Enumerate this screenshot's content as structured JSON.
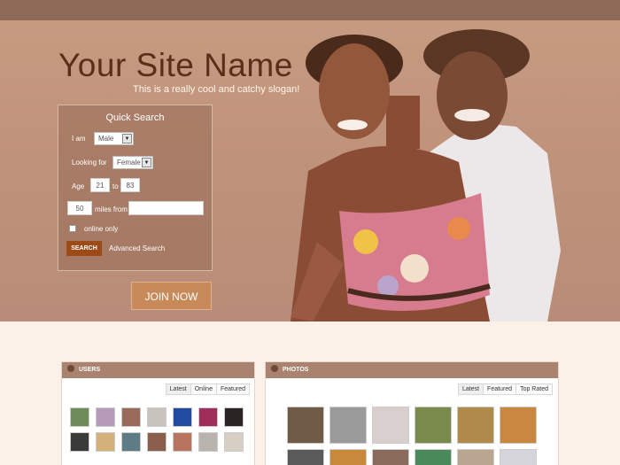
{
  "header": {
    "site_name": "Your Site Name",
    "slogan": "This is a really cool and catchy slogan!"
  },
  "quick_search": {
    "title": "Quick Search",
    "i_am_label": "I am",
    "i_am_value": "Male",
    "looking_for_label": "Looking for",
    "looking_for_value": "Female",
    "age_label": "Age",
    "age_from": "21",
    "age_to_label": "to",
    "age_to": "83",
    "miles_value": "50",
    "miles_from_label": "miles from",
    "location_value": "",
    "online_only_label": "online only",
    "search_button": "SEARCH",
    "advanced_link": "Advanced Search"
  },
  "join_button": "JOIN NOW",
  "users_panel": {
    "title": "USERS",
    "icon": "user-icon",
    "tabs": [
      "Latest",
      "Online",
      "Featured"
    ]
  },
  "photos_panel": {
    "title": "PHOTOS",
    "icon": "camera-icon",
    "tabs": [
      "Latest",
      "Featured",
      "Top Rated"
    ]
  },
  "colors": {
    "topbar": "#8d6a58",
    "hero": "#c09480",
    "title_brown": "#5a2f17",
    "search_button": "#9b4a18",
    "join_button": "#c98a5a",
    "panel_header": "#a9836f"
  }
}
